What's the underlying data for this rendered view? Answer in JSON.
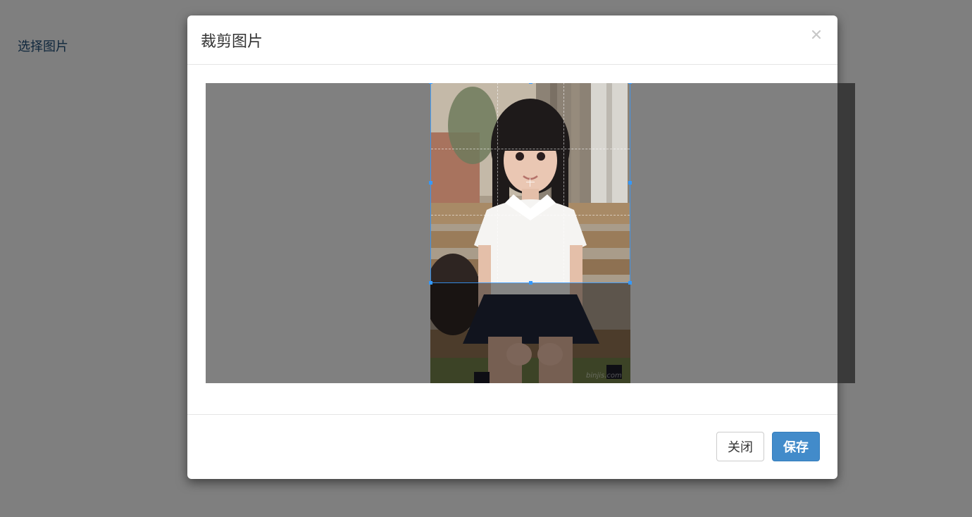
{
  "page": {
    "select_image_link": "选择图片"
  },
  "modal": {
    "title": "裁剪图片",
    "close_icon": "close-icon",
    "watermark": "binjis.com",
    "buttons": {
      "close_label": "关闭",
      "save_label": "保存"
    }
  },
  "colors": {
    "backdrop": "#808080",
    "crop_border": "#3399ff",
    "primary_button": "#428bca",
    "link": "#1f4e79"
  }
}
